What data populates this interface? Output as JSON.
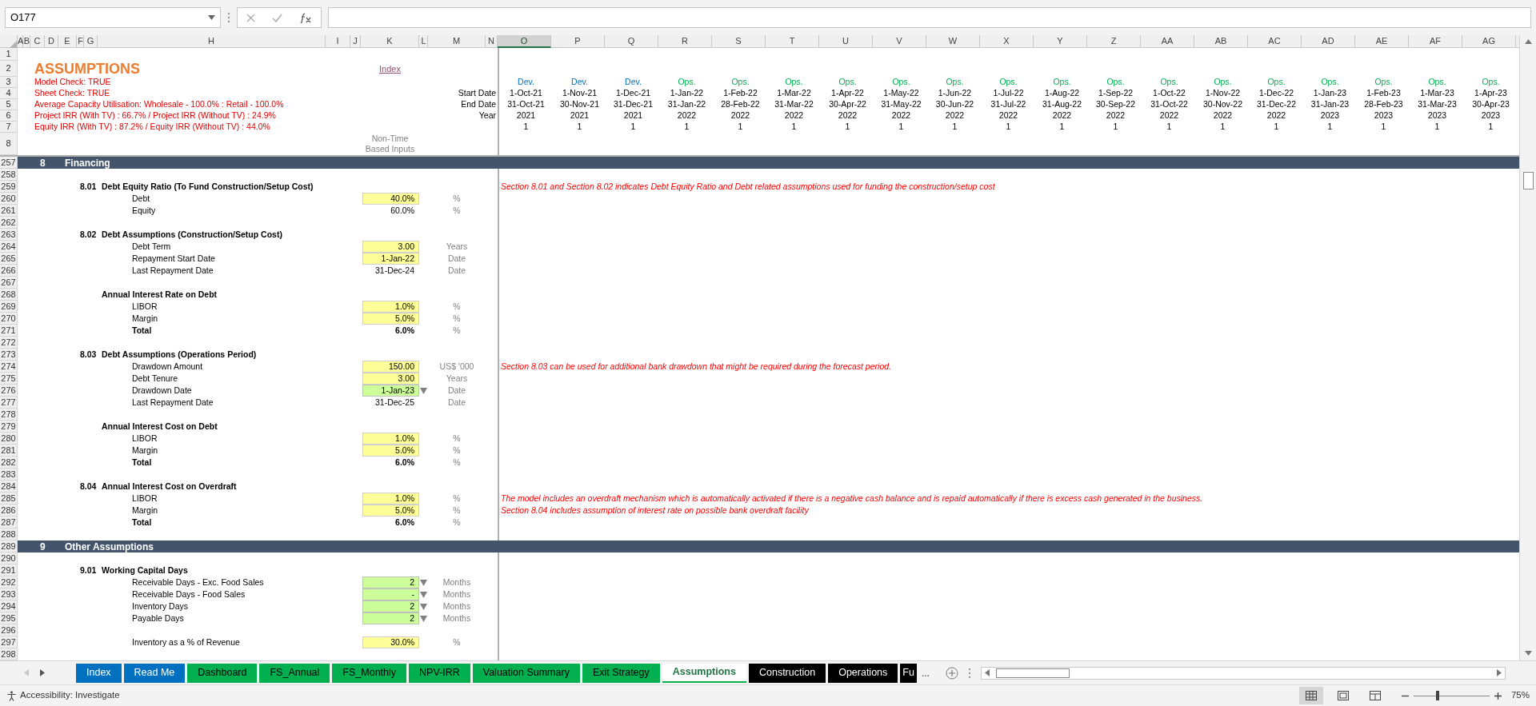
{
  "name_box": "O177",
  "columns": [
    {
      "label": "A",
      "selected": false
    },
    {
      "label": "B",
      "selected": false
    },
    {
      "label": "C",
      "selected": false
    },
    {
      "label": "D",
      "selected": false
    },
    {
      "label": "E",
      "selected": false
    },
    {
      "label": "F",
      "selected": false
    },
    {
      "label": "G",
      "selected": false
    },
    {
      "label": "H",
      "selected": false
    },
    {
      "label": "I",
      "selected": false
    },
    {
      "label": "J",
      "selected": false
    },
    {
      "label": "K",
      "selected": false
    },
    {
      "label": "L",
      "selected": false
    },
    {
      "label": "M",
      "selected": false
    },
    {
      "label": "N",
      "selected": false
    },
    {
      "label": "O",
      "selected": true
    },
    {
      "label": "P",
      "selected": false
    },
    {
      "label": "Q",
      "selected": false
    },
    {
      "label": "R",
      "selected": false
    },
    {
      "label": "S",
      "selected": false
    },
    {
      "label": "T",
      "selected": false
    },
    {
      "label": "U",
      "selected": false
    },
    {
      "label": "V",
      "selected": false
    },
    {
      "label": "W",
      "selected": false
    },
    {
      "label": "X",
      "selected": false
    },
    {
      "label": "Y",
      "selected": false
    },
    {
      "label": "Z",
      "selected": false
    },
    {
      "label": "AA",
      "selected": false
    },
    {
      "label": "AB",
      "selected": false
    },
    {
      "label": "AC",
      "selected": false
    },
    {
      "label": "AD",
      "selected": false
    },
    {
      "label": "AE",
      "selected": false
    },
    {
      "label": "AF",
      "selected": false
    },
    {
      "label": "AG",
      "selected": false
    }
  ],
  "header": {
    "row_numbers": [
      "1",
      "2",
      "3",
      "4",
      "5",
      "6",
      "7",
      "8"
    ],
    "title": "ASSUMPTIONS",
    "index_link": "Index",
    "checks": [
      "Model Check: TRUE",
      "Sheet Check: TRUE",
      "Average Capacity Utilisation: Wholesale - 100.0%  : Retail - 100.0%",
      "Project IRR  (With TV) : 66.7%  / Project IRR (Without TV) : 24.9%",
      "Equity IRR  (With TV) : 87.2%  / Equity IRR (Without TV) : 44.0%"
    ],
    "period_labels": [
      "Start Date",
      "End Date",
      "Year"
    ],
    "inputs_note": "Non-Time Based Inputs"
  },
  "periods": [
    {
      "phase": "Dev.",
      "kind": "dev",
      "start": "1-Oct-21",
      "end": "31-Oct-21",
      "year": "2021",
      "flag": "1"
    },
    {
      "phase": "Dev.",
      "kind": "dev",
      "start": "1-Nov-21",
      "end": "30-Nov-21",
      "year": "2021",
      "flag": "1"
    },
    {
      "phase": "Dev.",
      "kind": "dev",
      "start": "1-Dec-21",
      "end": "31-Dec-21",
      "year": "2021",
      "flag": "1"
    },
    {
      "phase": "Ops.",
      "kind": "ops",
      "start": "1-Jan-22",
      "end": "31-Jan-22",
      "year": "2022",
      "flag": "1"
    },
    {
      "phase": "Ops.",
      "kind": "ops",
      "start": "1-Feb-22",
      "end": "28-Feb-22",
      "year": "2022",
      "flag": "1"
    },
    {
      "phase": "Ops.",
      "kind": "ops",
      "start": "1-Mar-22",
      "end": "31-Mar-22",
      "year": "2022",
      "flag": "1"
    },
    {
      "phase": "Ops.",
      "kind": "ops",
      "start": "1-Apr-22",
      "end": "30-Apr-22",
      "year": "2022",
      "flag": "1"
    },
    {
      "phase": "Ops.",
      "kind": "ops",
      "start": "1-May-22",
      "end": "31-May-22",
      "year": "2022",
      "flag": "1"
    },
    {
      "phase": "Ops.",
      "kind": "ops",
      "start": "1-Jun-22",
      "end": "30-Jun-22",
      "year": "2022",
      "flag": "1"
    },
    {
      "phase": "Ops.",
      "kind": "ops",
      "start": "1-Jul-22",
      "end": "31-Jul-22",
      "year": "2022",
      "flag": "1"
    },
    {
      "phase": "Ops.",
      "kind": "ops",
      "start": "1-Aug-22",
      "end": "31-Aug-22",
      "year": "2022",
      "flag": "1"
    },
    {
      "phase": "Ops.",
      "kind": "ops",
      "start": "1-Sep-22",
      "end": "30-Sep-22",
      "year": "2022",
      "flag": "1"
    },
    {
      "phase": "Ops.",
      "kind": "ops",
      "start": "1-Oct-22",
      "end": "31-Oct-22",
      "year": "2022",
      "flag": "1"
    },
    {
      "phase": "Ops.",
      "kind": "ops",
      "start": "1-Nov-22",
      "end": "30-Nov-22",
      "year": "2022",
      "flag": "1"
    },
    {
      "phase": "Ops.",
      "kind": "ops",
      "start": "1-Dec-22",
      "end": "31-Dec-22",
      "year": "2022",
      "flag": "1"
    },
    {
      "phase": "Ops.",
      "kind": "ops",
      "start": "1-Jan-23",
      "end": "31-Jan-23",
      "year": "2023",
      "flag": "1"
    },
    {
      "phase": "Ops.",
      "kind": "ops",
      "start": "1-Feb-23",
      "end": "28-Feb-23",
      "year": "2023",
      "flag": "1"
    },
    {
      "phase": "Ops.",
      "kind": "ops",
      "start": "1-Mar-23",
      "end": "31-Mar-23",
      "year": "2023",
      "flag": "1"
    },
    {
      "phase": "Ops.",
      "kind": "ops",
      "start": "1-Apr-23",
      "end": "30-Apr-23",
      "year": "2023",
      "flag": "1"
    }
  ],
  "rows": [
    {
      "num": "257",
      "kind": "section",
      "number": "8",
      "label": "Financing"
    },
    {
      "num": "258",
      "kind": "blank"
    },
    {
      "num": "259",
      "kind": "heading",
      "number": "8.01",
      "label": "Debt Equity Ratio (To Fund Construction/Setup Cost)",
      "note": "Section 8.01 and Section 8.02 indicates Debt Equity Ratio and Debt related assumptions used for funding the construction/setup cost"
    },
    {
      "num": "260",
      "kind": "item",
      "label": "Debt",
      "value": "40.0%",
      "input": true,
      "dropdown": false,
      "unit": "%",
      "bold": false
    },
    {
      "num": "261",
      "kind": "item",
      "label": "Equity",
      "value": "60.0%",
      "input": false,
      "dropdown": false,
      "unit": "%",
      "bold": false
    },
    {
      "num": "262",
      "kind": "blank"
    },
    {
      "num": "263",
      "kind": "heading",
      "number": "8.02",
      "label": "Debt Assumptions (Construction/Setup Cost)"
    },
    {
      "num": "264",
      "kind": "item",
      "label": "Debt Term",
      "value": "3.00",
      "input": true,
      "dropdown": false,
      "unit": "Years",
      "bold": false
    },
    {
      "num": "265",
      "kind": "item",
      "label": "Repayment Start Date",
      "value": "1-Jan-22",
      "input": true,
      "dropdown": false,
      "unit": "Date",
      "bold": false
    },
    {
      "num": "266",
      "kind": "item",
      "label": "Last Repayment Date",
      "value": "31-Dec-24",
      "input": false,
      "dropdown": false,
      "unit": "Date",
      "bold": false
    },
    {
      "num": "267",
      "kind": "blank"
    },
    {
      "num": "268",
      "kind": "subheading",
      "label": "Annual Interest Rate on Debt"
    },
    {
      "num": "269",
      "kind": "item",
      "label": "LIBOR",
      "value": "1.0%",
      "input": true,
      "dropdown": false,
      "unit": "%",
      "bold": false
    },
    {
      "num": "270",
      "kind": "item",
      "label": "Margin",
      "value": "5.0%",
      "input": true,
      "dropdown": false,
      "unit": "%",
      "bold": false
    },
    {
      "num": "271",
      "kind": "item",
      "label": "Total",
      "value": "6.0%",
      "input": false,
      "dropdown": false,
      "unit": "%",
      "bold": true
    },
    {
      "num": "272",
      "kind": "blank"
    },
    {
      "num": "273",
      "kind": "heading",
      "number": "8.03",
      "label": "Debt Assumptions (Operations Period)"
    },
    {
      "num": "274",
      "kind": "item",
      "label": "Drawdown Amount",
      "value": "150.00",
      "input": true,
      "dropdown": false,
      "unit": "US$ '000",
      "bold": false,
      "note": "Section 8.03 can be used for additional bank drawdown that might be required during the forecast period."
    },
    {
      "num": "275",
      "kind": "item",
      "label": "Debt Tenure",
      "value": "3.00",
      "input": true,
      "dropdown": false,
      "unit": "Years",
      "bold": false
    },
    {
      "num": "276",
      "kind": "item",
      "label": "Drawdown Date",
      "value": "1-Jan-23",
      "input": true,
      "dropdown": true,
      "unit": "Date",
      "bold": false
    },
    {
      "num": "277",
      "kind": "item",
      "label": "Last Repayment Date",
      "value": "31-Dec-25",
      "input": false,
      "dropdown": false,
      "unit": "Date",
      "bold": false
    },
    {
      "num": "278",
      "kind": "blank"
    },
    {
      "num": "279",
      "kind": "subheading",
      "label": "Annual Interest Cost on Debt"
    },
    {
      "num": "280",
      "kind": "item",
      "label": "LIBOR",
      "value": "1.0%",
      "input": true,
      "dropdown": false,
      "unit": "%",
      "bold": false
    },
    {
      "num": "281",
      "kind": "item",
      "label": "Margin",
      "value": "5.0%",
      "input": true,
      "dropdown": false,
      "unit": "%",
      "bold": false
    },
    {
      "num": "282",
      "kind": "item",
      "label": "Total",
      "value": "6.0%",
      "input": false,
      "dropdown": false,
      "unit": "%",
      "bold": true
    },
    {
      "num": "283",
      "kind": "blank"
    },
    {
      "num": "284",
      "kind": "heading",
      "number": "8.04",
      "label": "Annual Interest Cost on Overdraft"
    },
    {
      "num": "285",
      "kind": "item",
      "label": "LIBOR",
      "value": "1.0%",
      "input": true,
      "dropdown": false,
      "unit": "%",
      "bold": false,
      "note": "The model includes an overdraft mechanism which is automatically activated if there is a negative cash balance and is repaid automatically if there is excess cash generated in the business."
    },
    {
      "num": "286",
      "kind": "item",
      "label": "Margin",
      "value": "5.0%",
      "input": true,
      "dropdown": false,
      "unit": "%",
      "bold": false,
      "note": "Section 8.04 includes assumption of interest rate on possible bank overdraft facility"
    },
    {
      "num": "287",
      "kind": "item",
      "label": "Total",
      "value": "6.0%",
      "input": false,
      "dropdown": false,
      "unit": "%",
      "bold": true
    },
    {
      "num": "288",
      "kind": "blank"
    },
    {
      "num": "289",
      "kind": "section",
      "number": "9",
      "label": "Other Assumptions"
    },
    {
      "num": "290",
      "kind": "blank"
    },
    {
      "num": "291",
      "kind": "heading",
      "number": "9.01",
      "label": "Working Capital Days"
    },
    {
      "num": "292",
      "kind": "item",
      "label": "Receivable Days - Exc. Food Sales",
      "value": "2",
      "input": true,
      "dropdown": true,
      "unit": "Months",
      "bold": false
    },
    {
      "num": "293",
      "kind": "item",
      "label": "Receivable Days - Food Sales",
      "value": "-",
      "input": true,
      "dropdown": true,
      "unit": "Months",
      "bold": false
    },
    {
      "num": "294",
      "kind": "item",
      "label": "Inventory Days",
      "value": "2",
      "input": true,
      "dropdown": true,
      "unit": "Months",
      "bold": false
    },
    {
      "num": "295",
      "kind": "item",
      "label": "Payable Days",
      "value": "2",
      "input": true,
      "dropdown": true,
      "unit": "Months",
      "bold": false
    },
    {
      "num": "296",
      "kind": "blank"
    },
    {
      "num": "297",
      "kind": "item",
      "label": "Inventory as a % of Revenue",
      "value": "30.0%",
      "input": true,
      "dropdown": false,
      "unit": "%",
      "bold": false
    },
    {
      "num": "298",
      "kind": "blank"
    }
  ],
  "sheet_tabs": [
    {
      "label": "Index",
      "color": "#0070c0",
      "selected": false
    },
    {
      "label": "Read Me",
      "color": "#0070c0",
      "selected": false
    },
    {
      "label": "Dashboard",
      "color": "#00b050",
      "selected": false
    },
    {
      "label": "FS_Annual",
      "color": "#00b050",
      "selected": false
    },
    {
      "label": "FS_Monthly",
      "color": "#00b050",
      "selected": false
    },
    {
      "label": "NPV-IRR",
      "color": "#00b050",
      "selected": false
    },
    {
      "label": "Valuation Summary",
      "color": "#00b050",
      "selected": false
    },
    {
      "label": "Exit Strategy",
      "color": "#00b050",
      "selected": false
    },
    {
      "label": "Assumptions",
      "color": "#00b050",
      "selected": true
    },
    {
      "label": "Construction",
      "color": "#000000",
      "selected": false
    },
    {
      "label": "Operations",
      "color": "#000000",
      "selected": false
    },
    {
      "label": "Fu",
      "color": "#000000",
      "selected": false
    }
  ],
  "tabs_more": "...",
  "status": {
    "accessibility": "Accessibility: Investigate",
    "zoom": "75%",
    "zoom_slider": {
      "level": 0.31
    },
    "views": [
      {
        "kind": "normal",
        "selected": true
      },
      {
        "kind": "page_layout",
        "selected": false
      },
      {
        "kind": "page_break",
        "selected": false
      }
    ]
  }
}
